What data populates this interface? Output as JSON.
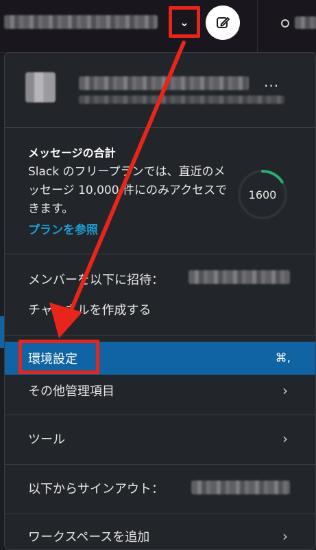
{
  "topbar": {
    "chevron_icon": "chevron-down-icon",
    "compose_icon": "compose-icon",
    "status_icon": "status-circle-icon"
  },
  "account": {
    "more_label": "···"
  },
  "usage": {
    "title": "メッセージの合計",
    "body": "Slack のフリープランでは、直近のメッセージ 10,000 件にのみアクセスできます。",
    "link": "プランを参照",
    "count": "1600",
    "progress_fraction": 0.16
  },
  "menu": {
    "invite_label": "メンバーを以下に招待：",
    "create_channel_label": "チャンネルを作成する",
    "preferences_label": "環境設定",
    "preferences_shortcut": "⌘,",
    "admin_label": "その他管理項目",
    "tools_label": "ツール",
    "signout_label": "以下からサインアウト：",
    "add_workspace_label": "ワークスペースを追加"
  },
  "colors": {
    "highlight": "#1164a3",
    "annotation": "#e8251b",
    "link": "#1d9bd1",
    "progress": "#2bac76"
  }
}
